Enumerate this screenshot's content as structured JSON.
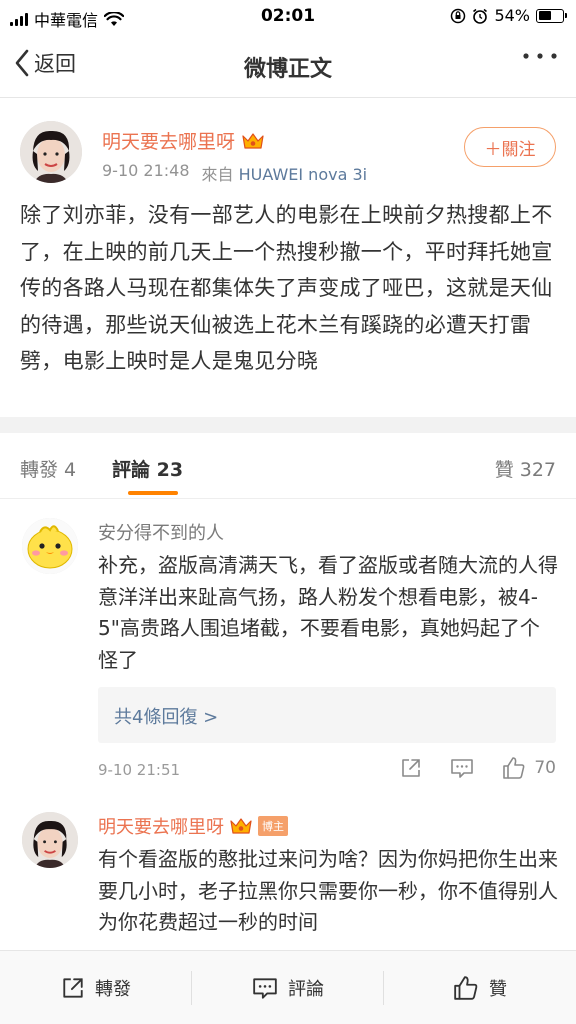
{
  "status_bar": {
    "carrier": "中華電信",
    "time": "02:01",
    "battery": "54%",
    "battery_level": 0.54
  },
  "nav": {
    "back_label": "返回",
    "title": "微博正文"
  },
  "post": {
    "author": "明天要去哪里呀",
    "follow_label": "＋關注",
    "date": "9-10 21:48",
    "source_prefix": "來自",
    "device": "HUAWEI nova 3i",
    "text": "除了刘亦菲，没有一部艺人的电影在上映前夕热搜都上不了，在上映的前几天上一个热搜秒撤一个，平时拜托她宣传的各路人马现在都集体失了声变成了哑巴，这就是天仙的待遇，那些说天仙被选上花木兰有蹊跷的必遭天打雷劈，电影上映时是人是鬼见分晓"
  },
  "tabs": {
    "repost": "轉發 4",
    "comment": "評論 23",
    "like": "贊 327"
  },
  "comments": [
    {
      "author": "安分得不到的人",
      "text": "补充，盗版高清满天飞，看了盗版或者随大流的人得意洋洋出来趾高气扬，路人粉发个想看电影，被4-5\"高贵路人围追堵截，不要看电影，真她妈起了个怪了",
      "replies_link": "共4條回復 >",
      "time": "9-10 21:51",
      "likes": "70"
    },
    {
      "author": "明天要去哪里呀",
      "badge": "博主",
      "text": "有个看盗版的憨批过来问为啥？因为你妈把你生出来要几小时，老子拉黑你只需要你一秒，你不值得别人为你花费超过一秒的时间"
    }
  ],
  "bottom_bar": {
    "repost": "轉發",
    "comment": "評論",
    "like": "贊"
  },
  "colors": {
    "accent_orange": "#ff8200",
    "name_orange": "#eb7350",
    "link_blue": "#5d7a9c"
  },
  "icons": [
    "back-chevron-icon",
    "more-dots-icon",
    "crown-vip-icon",
    "share-icon",
    "comment-icon",
    "thumbs-up-icon",
    "wifi-icon",
    "signal-icon",
    "alarm-icon",
    "rotation-lock-icon"
  ]
}
